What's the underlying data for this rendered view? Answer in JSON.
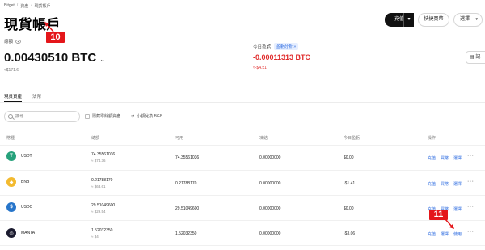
{
  "breadcrumb": [
    "Bitget",
    "資產",
    "現貨帳戶"
  ],
  "title": "現貨帳戶",
  "annotations": {
    "a10": "10",
    "a11": "11"
  },
  "header_buttons": {
    "deposit": "充值",
    "quick_trade": "快捷買幣",
    "select": "選擇"
  },
  "balance": {
    "label": "總額",
    "btc": "0.00430510 BTC",
    "usd": "≈$171.6"
  },
  "pnl": {
    "label": "今日盈虧",
    "badge": "盈虧分析 »",
    "btc": "-0.00011313 BTC",
    "usd": "≈-$4.51"
  },
  "records_button": "記",
  "tabs": [
    "現貨資產",
    "法幣"
  ],
  "search": {
    "placeholder": "搜尋"
  },
  "filters": {
    "hide_small": "隱藏零餘額資產",
    "convert": "小額兌換 BGB"
  },
  "table": {
    "headers": [
      "幣種",
      "總額",
      "可用",
      "凍結",
      "今日盈虧",
      "操作"
    ],
    "rows": [
      {
        "coin": "USDT",
        "total": "74.35561036",
        "total_usd": "≈ $74.36",
        "available": "74.35561036",
        "frozen": "0.00000000",
        "pnl": "$0.00",
        "actions": [
          "充值",
          "買幣",
          "選擇"
        ],
        "more": "···",
        "color": "#26a17b",
        "glyph": "T"
      },
      {
        "coin": "BNB",
        "total": "0.21788170",
        "total_usd": "≈ $63.61",
        "available": "0.21788170",
        "frozen": "0.00000000",
        "pnl": "-$1.41",
        "actions": [
          "充值",
          "買幣",
          "選擇"
        ],
        "more": "···",
        "color": "#f3ba2f",
        "glyph": "◆"
      },
      {
        "coin": "USDC",
        "total": "29.51049600",
        "total_usd": "≈ $29.54",
        "available": "29.51049600",
        "frozen": "0.00000000",
        "pnl": "$0.00",
        "actions": [
          "充值",
          "買幣",
          "選擇"
        ],
        "more": "···",
        "color": "#2775ca",
        "glyph": "$"
      },
      {
        "coin": "MANTA",
        "total": "1.52032350",
        "total_usd": "≈ $4",
        "available": "1.52032350",
        "frozen": "0.00000000",
        "pnl": "-$3.06",
        "actions": [
          "充值",
          "選擇",
          "使用"
        ],
        "more": "···",
        "color": "#1b1b2f",
        "glyph": "◎"
      }
    ]
  },
  "colors": {
    "accent": "#2c6be0",
    "negative": "#e02b2b",
    "annotation": "#e4161a"
  }
}
